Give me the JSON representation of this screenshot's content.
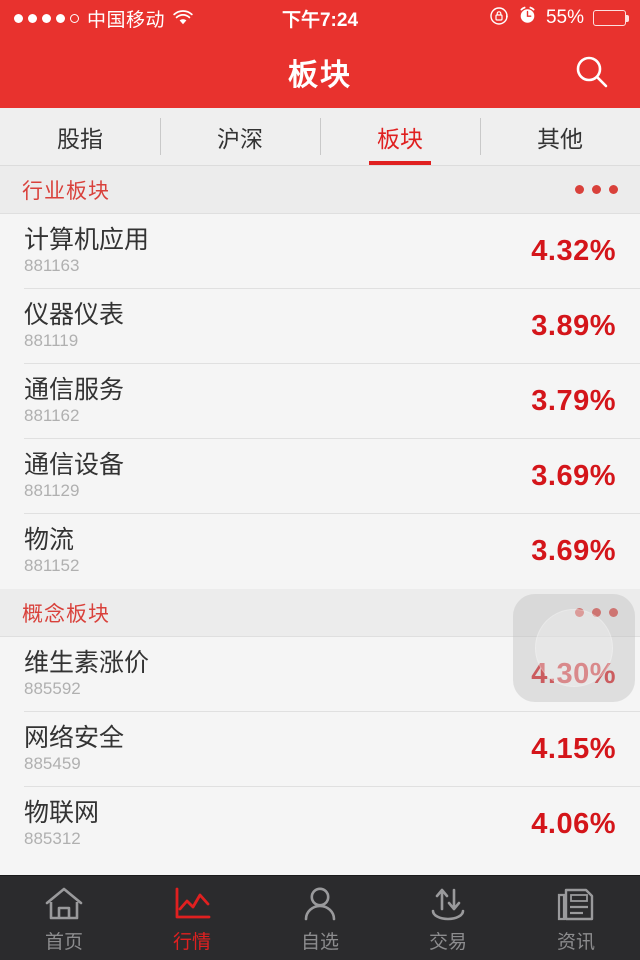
{
  "status_bar": {
    "signal_dots_filled": 4,
    "signal_dots_total": 5,
    "carrier": "中国移动",
    "wifi_icon": "wifi-icon",
    "time": "下午7:24",
    "rotation_lock_icon": "rotation-lock-icon",
    "alarm_icon": "alarm-clock-icon",
    "battery_percent": "55%",
    "battery_level": 55
  },
  "navbar": {
    "title": "板块",
    "search_icon": "search-icon"
  },
  "tabs": [
    {
      "label": "股指",
      "active": false
    },
    {
      "label": "沪深",
      "active": false
    },
    {
      "label": "板块",
      "active": true
    },
    {
      "label": "其他",
      "active": false
    }
  ],
  "sections": [
    {
      "title": "行业板块",
      "more_icon": "more-dots-icon",
      "rows": [
        {
          "name": "计算机应用",
          "code": "881163",
          "change": "4.32%"
        },
        {
          "name": "仪器仪表",
          "code": "881119",
          "change": "3.89%"
        },
        {
          "name": "通信服务",
          "code": "881162",
          "change": "3.79%"
        },
        {
          "name": "通信设备",
          "code": "881129",
          "change": "3.69%"
        },
        {
          "name": "物流",
          "code": "881152",
          "change": "3.69%"
        }
      ]
    },
    {
      "title": "概念板块",
      "more_icon": "more-dots-icon",
      "rows": [
        {
          "name": "维生素涨价",
          "code": "885592",
          "change": "4.30%"
        },
        {
          "name": "网络安全",
          "code": "885459",
          "change": "4.15%"
        },
        {
          "name": "物联网",
          "code": "885312",
          "change": "4.06%"
        }
      ]
    }
  ],
  "assistive_touch": {
    "visible": true,
    "icon": "assistive-touch-icon"
  },
  "bottom_nav": [
    {
      "label": "首页",
      "icon": "home-icon",
      "active": false
    },
    {
      "label": "行情",
      "icon": "chart-icon",
      "active": true
    },
    {
      "label": "自选",
      "icon": "person-icon",
      "active": false
    },
    {
      "label": "交易",
      "icon": "trade-arrows-icon",
      "active": false
    },
    {
      "label": "资讯",
      "icon": "news-icon",
      "active": false
    }
  ],
  "colors": {
    "brand_red": "#E8322E",
    "accent_red": "#E02020",
    "up_red": "#D4151A",
    "section_red": "#D9413B",
    "list_bg": "#F5F5F5",
    "section_bg": "#ECECEC",
    "bottom_nav_bg": "#2B2B2D",
    "muted_text": "#B0B0B0"
  }
}
